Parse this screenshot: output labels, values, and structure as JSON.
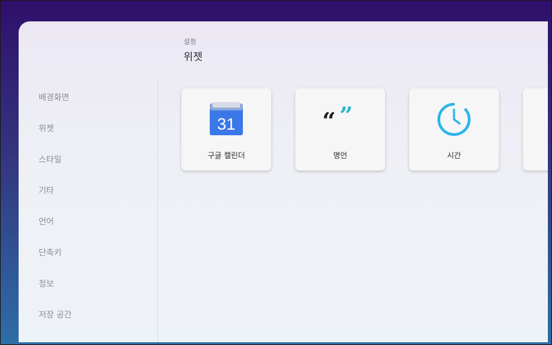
{
  "header": {
    "breadcrumb": "설정",
    "title": "위젯"
  },
  "sidebar": {
    "items": [
      {
        "label": "배경화면"
      },
      {
        "label": "위젯"
      },
      {
        "label": "스타일"
      },
      {
        "label": "기타"
      },
      {
        "label": "언어"
      },
      {
        "label": "단축키"
      },
      {
        "label": "정보"
      },
      {
        "label": "저장 공간"
      }
    ]
  },
  "widgets": [
    {
      "label": "구글 캘린더",
      "icon": "google-calendar-icon",
      "icon_text": "31",
      "color": "#3b78e7"
    },
    {
      "label": "명언",
      "icon": "quote-icon",
      "color": "#2bb3c9"
    },
    {
      "label": "시간",
      "icon": "clock-icon",
      "color": "#2bb5e8"
    }
  ],
  "colors": {
    "accent_quote": "#2bb3c9",
    "accent_clock": "#2bb5e8",
    "calendar_blue": "#3b78e7"
  }
}
